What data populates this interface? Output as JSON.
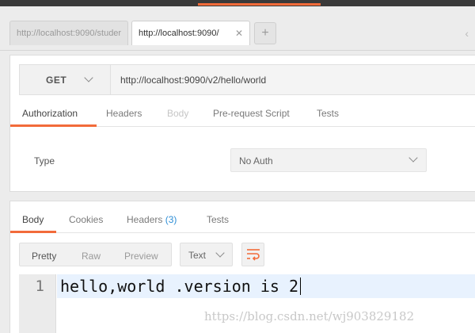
{
  "tabs": [
    {
      "label": "http://localhost:9090/studer"
    },
    {
      "label": "http://localhost:9090/"
    }
  ],
  "request": {
    "method": "GET",
    "url": "http://localhost:9090/v2/hello/world",
    "tabs": [
      "Authorization",
      "Headers",
      "Body",
      "Pre-request Script",
      "Tests"
    ],
    "active_tab": "Authorization",
    "auth": {
      "type_label": "Type",
      "type_value": "No Auth"
    }
  },
  "response": {
    "tabs": {
      "body": "Body",
      "cookies": "Cookies",
      "headers": "Headers",
      "headers_count": "(3)",
      "tests": "Tests"
    },
    "formats": [
      "Pretty",
      "Raw",
      "Preview"
    ],
    "language": "Text",
    "line_number": "1",
    "body": "hello,world .version is 2"
  },
  "watermark": "https://blog.csdn.net/wj903829182",
  "colors": {
    "accent": "#f26b3a",
    "link_count": "#2f8fd6"
  }
}
